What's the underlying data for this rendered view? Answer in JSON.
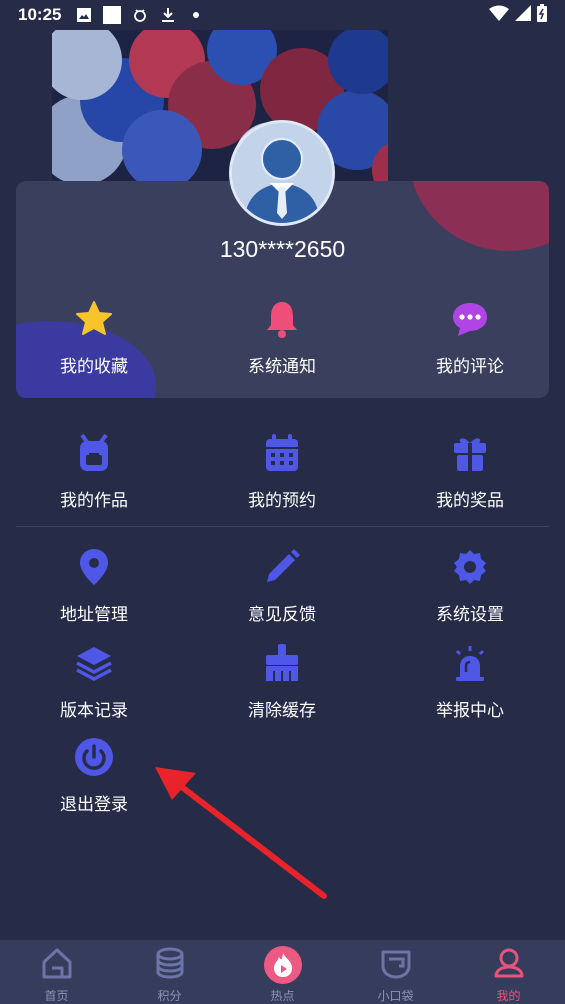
{
  "status_bar": {
    "time": "10:25",
    "icons": [
      "image-icon",
      "white-square-icon",
      "bug-icon",
      "download-icon",
      "dot-icon"
    ],
    "right_icons": [
      "wifi-icon",
      "signal-icon",
      "battery-icon"
    ]
  },
  "profile": {
    "phone": "130****2650"
  },
  "quick_actions": [
    {
      "label": "我的收藏",
      "icon": "star-icon"
    },
    {
      "label": "系统通知",
      "icon": "bell-icon"
    },
    {
      "label": "我的评论",
      "icon": "comment-icon"
    }
  ],
  "menu_row1": [
    {
      "label": "我的作品",
      "icon": "backpack-icon"
    },
    {
      "label": "我的预约",
      "icon": "calendar-icon"
    },
    {
      "label": "我的奖品",
      "icon": "gift-icon"
    }
  ],
  "menu_row2": [
    {
      "label": "地址管理",
      "icon": "location-pin-icon"
    },
    {
      "label": "意见反馈",
      "icon": "pencil-icon"
    },
    {
      "label": "系统设置",
      "icon": "gear-icon"
    }
  ],
  "menu_row3": [
    {
      "label": "版本记录",
      "icon": "layers-icon"
    },
    {
      "label": "清除缓存",
      "icon": "broom-icon"
    },
    {
      "label": "举报中心",
      "icon": "alarm-siren-icon"
    }
  ],
  "menu_row4": [
    {
      "label": "退出登录",
      "icon": "power-icon"
    }
  ],
  "bottom_nav": [
    {
      "label": "首页",
      "icon": "home-icon"
    },
    {
      "label": "积分",
      "icon": "coins-icon"
    },
    {
      "label": "热点",
      "icon": "flame-play-icon"
    },
    {
      "label": "小口袋",
      "icon": "pocket-icon"
    },
    {
      "label": "我的",
      "icon": "user-icon"
    }
  ],
  "colors": {
    "background": "#262c48",
    "card": "#3a3f5d",
    "accent_blue": "#4e57e6",
    "star": "#f7c52b",
    "bell": "#f04e7a",
    "comment": "#b144e6",
    "nav_active": "#e8537a",
    "arrow": "#e8232a"
  }
}
